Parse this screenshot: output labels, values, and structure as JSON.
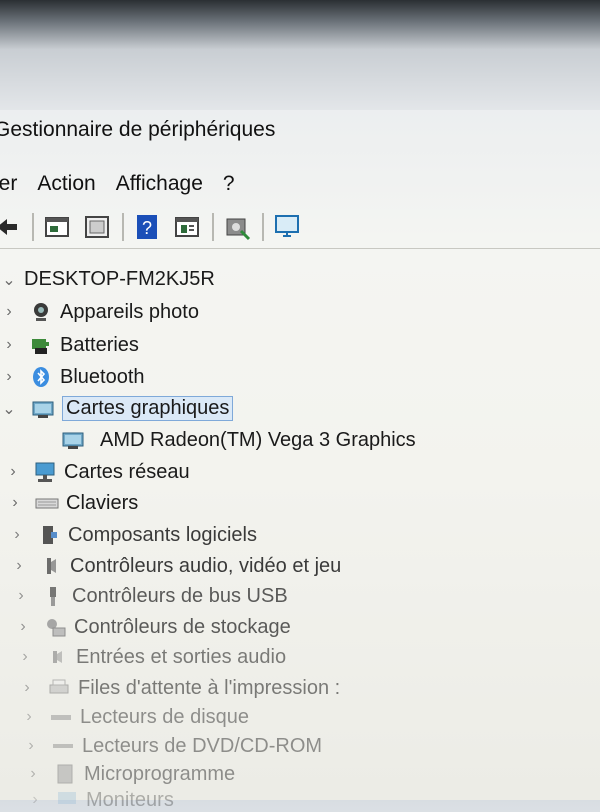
{
  "window": {
    "title": "Gestionnaire de périphériques"
  },
  "menu": {
    "items": [
      "ier",
      "Action",
      "Affichage",
      "?"
    ]
  },
  "toolbar": {
    "buttons": [
      "back-icon",
      "properties-icon",
      "list-icon",
      "help-icon",
      "view-icon",
      "scan-hardware-icon",
      "monitor-icon"
    ]
  },
  "tree": {
    "root": "DESKTOP-FM2KJ5R",
    "categories": [
      {
        "label": "Appareils photo",
        "icon": "camera-icon",
        "expanded": false
      },
      {
        "label": "Batteries",
        "icon": "battery-icon",
        "expanded": false
      },
      {
        "label": "Bluetooth",
        "icon": "bluetooth-icon",
        "expanded": false
      },
      {
        "label": "Cartes graphiques",
        "icon": "display-adapter-icon",
        "expanded": true,
        "selected": true,
        "children": [
          {
            "label": "AMD Radeon(TM) Vega 3 Graphics",
            "icon": "display-adapter-icon"
          }
        ]
      },
      {
        "label": "Cartes réseau",
        "icon": "network-icon",
        "expanded": false
      },
      {
        "label": "Claviers",
        "icon": "keyboard-icon",
        "expanded": false
      },
      {
        "label": "Composants logiciels",
        "icon": "software-icon",
        "expanded": false
      },
      {
        "label": "Contrôleurs audio, vidéo et jeu",
        "icon": "audio-icon",
        "expanded": false
      },
      {
        "label": "Contrôleurs de bus USB",
        "icon": "usb-icon",
        "expanded": false
      },
      {
        "label": "Contrôleurs de stockage",
        "icon": "storage-icon",
        "expanded": false
      },
      {
        "label": "Entrées et sorties audio",
        "icon": "speaker-icon",
        "expanded": false
      },
      {
        "label": "Files d'attente à l'impression :",
        "icon": "printer-icon",
        "expanded": false
      },
      {
        "label": "Lecteurs de disque",
        "icon": "disk-icon",
        "expanded": false
      },
      {
        "label": "Lecteurs de DVD/CD-ROM",
        "icon": "dvd-icon",
        "expanded": false
      },
      {
        "label": "Microprogramme",
        "icon": "firmware-icon",
        "expanded": false
      },
      {
        "label": "Moniteurs",
        "icon": "monitor-icon",
        "expanded": false
      }
    ]
  }
}
